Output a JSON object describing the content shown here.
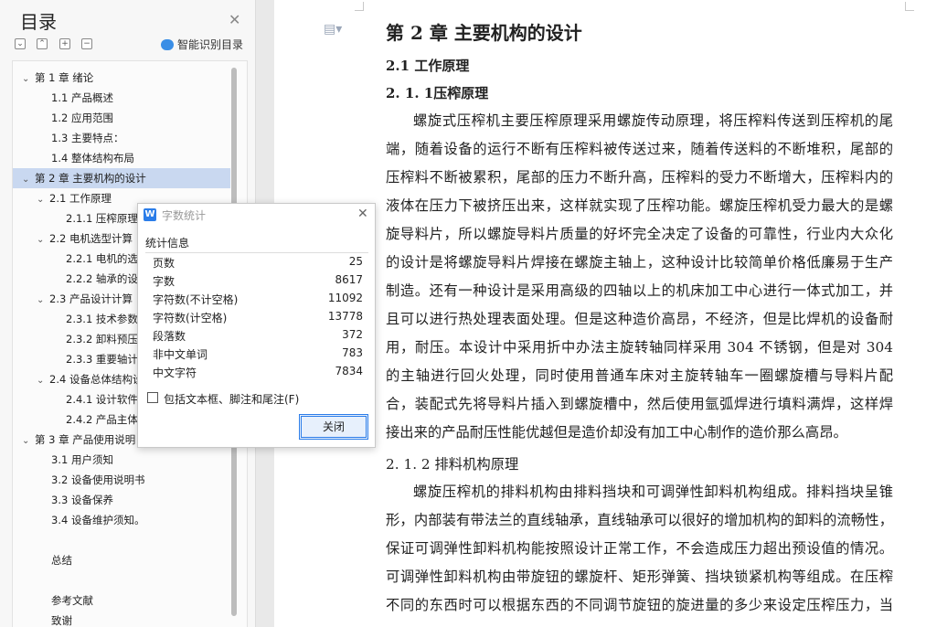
{
  "toc": {
    "title": "目录",
    "smart_label": "智能识别目录",
    "toolbar": [
      "⌄",
      "⌃",
      "+",
      "−"
    ],
    "items": [
      {
        "text": "第 1 章  绪论",
        "level": 0,
        "chev": "⌄"
      },
      {
        "text": "1.1 产品概述",
        "level": 1
      },
      {
        "text": "1.2  应用范围",
        "level": 1
      },
      {
        "text": "1.3 主要特点：",
        "level": 1
      },
      {
        "text": "1.4  整体结构布局",
        "level": 1
      },
      {
        "text": "第 2 章  主要机构的设计",
        "level": 0,
        "chev": "⌄",
        "selected": true
      },
      {
        "text": "2.1 工作原理",
        "level": 1,
        "chev": "⌄"
      },
      {
        "text": "2.1.1 压榨原理",
        "level": 2
      },
      {
        "text": "2.2 电机选型计算",
        "level": 1,
        "chev": "⌄"
      },
      {
        "text": "2.2.1 电机的选",
        "level": 2
      },
      {
        "text": "2.2.2 轴承的设",
        "level": 2
      },
      {
        "text": "2.3  产品设计计算",
        "level": 1,
        "chev": "⌄"
      },
      {
        "text": "2.3.1  技术参数",
        "level": 2
      },
      {
        "text": "2.3.2  卸料预压",
        "level": 2
      },
      {
        "text": "2.3.3  重要轴计",
        "level": 2
      },
      {
        "text": "2.4 设备总体结构设",
        "level": 1,
        "chev": "⌄"
      },
      {
        "text": "2.4.1 设计软件",
        "level": 2
      },
      {
        "text": "2.4.2 产品主体",
        "level": 2
      },
      {
        "text": "第 3 章  产品使用说明",
        "level": 0,
        "chev": "⌄"
      },
      {
        "text": "3.1  用户须知",
        "level": 1
      },
      {
        "text": "3.2  设备使用说明书",
        "level": 1
      },
      {
        "text": "3.3  设备保养",
        "level": 1
      },
      {
        "text": "3.4 设备维护须知。",
        "level": 1
      },
      {
        "text": "总结",
        "level": 1,
        "gap": true
      },
      {
        "text": "参考文献",
        "level": 1,
        "gap": true
      },
      {
        "text": "致谢",
        "level": 1
      }
    ]
  },
  "document": {
    "chapter_title": "第 2 章  主要机构的设计",
    "section_title": "2.1 工作原理",
    "subsection_title": "2. 1. 1压榨原理",
    "para1": [
      "螺旋式压榨机主要压榨原理采用螺旋传动原理，将压榨料传送到压榨机的尾",
      "端，随着设备的运行不断有压榨料被传送过来，随着传送料的不断堆积，尾部的",
      "压榨料不断被累积，尾部的压力不断升高，压榨料的受力不断增大，压榨料内的",
      "液体在压力下被挤压出来，这样就实现了压榨功能。螺旋压榨机受力最大的是螺",
      "旋导料片，所以螺旋导料片质量的好坏完全决定了设备的可靠性，行业内大众化",
      "的设计是将螺旋导料片焊接在螺旋主轴上，这种设计比较简单价格低廉易于生产",
      "制造。还有一种设计是采用高级的四轴以上的机床加工中心进行一体式加工，并",
      "且可以进行热处理表面处理。但是这种造价高昂，不经济，但是比焊机的设备耐",
      "用，耐压。本设计中采用折中办法主旋转轴同样采用 304 不锈钢，但是对 304",
      "的主轴进行回火处理，同时使用普通车床对主旋转轴车一圈螺旋槽与导料片配",
      "合，装配式先将导料片插入到螺旋槽中，然后使用氩弧焊进行填料满焊，这样焊",
      "接出来的产品耐压性能优越但是造价却没有加工中心制作的造价那么高昂。"
    ],
    "subsection2_title": "2. 1. 2  排料机构原理",
    "para2": [
      "螺旋压榨机的排料机构由排料挡块和可调弹性卸料机构组成。排料挡块呈锥",
      "形，内部装有带法兰的直线轴承，直线轴承可以很好的增加机构的卸料的流畅性，",
      "保证可调弹性卸料机构能按照设计正常工作，不会造成压力超出预设值的情况。",
      "可调弹性卸料机构由带旋钮的螺旋杆、矩形弹簧、挡块锁紧机构等组成。在压榨",
      "不同的东西时可以根据东西的不同调节旋钮的旋进量的多少来设定压榨压力，当"
    ]
  },
  "dialog": {
    "title": "字数统计",
    "section": "统计信息",
    "rows": [
      {
        "label": "页数",
        "value": "25"
      },
      {
        "label": "字数",
        "value": "8617"
      },
      {
        "label": "字符数(不计空格)",
        "value": "11092"
      },
      {
        "label": "字符数(计空格)",
        "value": "13778"
      },
      {
        "label": "段落数",
        "value": "372"
      },
      {
        "label": "非中文单词",
        "value": "783"
      },
      {
        "label": "中文字符",
        "value": "7834"
      }
    ],
    "checkbox_label": "包括文本框、脚注和尾注(F)",
    "checkbox_checked": false,
    "close_label": "关闭"
  }
}
